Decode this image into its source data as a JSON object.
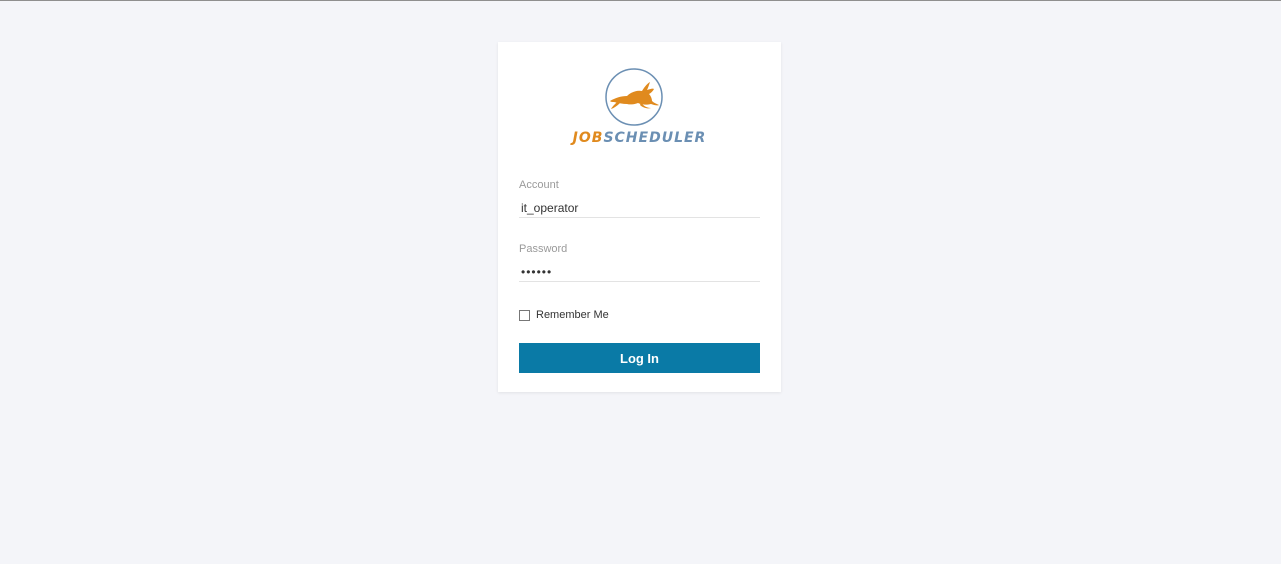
{
  "logo": {
    "text_part1": "JOB",
    "text_part2": "SCHEDULER",
    "icon": "rabbit-logo-icon",
    "colors": {
      "orange": "#e08a1e",
      "blue": "#6b8fb3"
    }
  },
  "form": {
    "account": {
      "label": "Account",
      "value": "it_operator"
    },
    "password": {
      "label": "Password",
      "value": "••••••"
    },
    "remember": {
      "label": "Remember Me",
      "checked": false
    },
    "submit_label": "Log In"
  },
  "colors": {
    "page_background": "#f4f5f9",
    "button": "#0a7aa6"
  }
}
